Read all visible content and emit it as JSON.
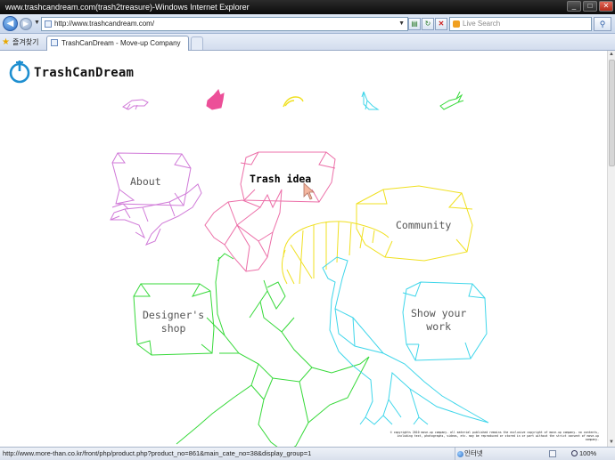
{
  "window": {
    "title": "www.trashcandream.com(trash2treasure)-Windows Internet Explorer",
    "controls": {
      "minimize": "_",
      "maximize": "□",
      "close": "✕"
    }
  },
  "navbar": {
    "back_icon": "back-arrow-icon",
    "forward_icon": "forward-arrow-icon",
    "address": "http://www.trashcandream.com/",
    "search_placeholder": "Live Search"
  },
  "tabs": {
    "favorites_label": "즐겨찾기",
    "items": [
      {
        "label": "TrashCanDream - Move-up Company"
      }
    ]
  },
  "page": {
    "logo_text": "TrashCanDream",
    "menu": [
      {
        "label": "About",
        "color": "#d07ad8",
        "active": false
      },
      {
        "label": "Trash idea",
        "color": "#ec6fa8",
        "active": true
      },
      {
        "label": "Community",
        "color": "#f0e020",
        "active": false
      },
      {
        "label": "Designer's\nshop",
        "color": "#37d93a",
        "active": false
      },
      {
        "label": "Show your\nwork",
        "color": "#3fd6ea",
        "active": false
      }
    ],
    "animal_icons": [
      {
        "icon": "crocodile-icon",
        "color": "#d07ad8"
      },
      {
        "icon": "rabbit-icon",
        "color": "#ec4f98"
      },
      {
        "icon": "worm-icon",
        "color": "#f0e020"
      },
      {
        "icon": "peacock-icon",
        "color": "#3fd6ea"
      },
      {
        "icon": "deer-icon",
        "color": "#37d93a"
      }
    ],
    "copyright": "© copyrights 2010 move-up company. all material published remains the exclusive copyright of move-up company. no contents, including text, photographs, videos, etc. may be reproduced or stored in or part without the strict consent of move-up company."
  },
  "statusbar": {
    "url": "http://www.more-than.co.kr/front/php/product.php?product_no=861&main_cate_no=38&display_group=1",
    "zone": "인터넷",
    "zoom": "100%"
  },
  "colors": {
    "about": "#d07ad8",
    "trash": "#ec6fa8",
    "community": "#f0e020",
    "designers": "#37d93a",
    "show": "#3fd6ea",
    "logo": "#1e8fd0"
  }
}
